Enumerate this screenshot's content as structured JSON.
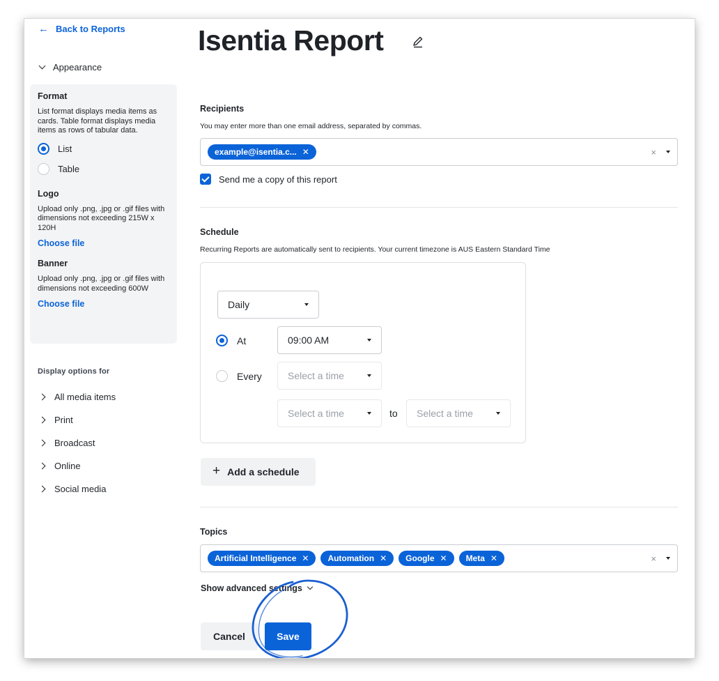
{
  "colors": {
    "accent": "#0b63d8",
    "panel_bg": "#f3f4f5",
    "scribble": "#1a5fd0"
  },
  "sidebar": {
    "back_label": "Back to Reports",
    "appearance_label": "Appearance",
    "format": {
      "heading": "Format",
      "description": "List format displays media items as cards. Table format displays media items as rows of tabular data.",
      "options": [
        {
          "label": "List",
          "selected": true
        },
        {
          "label": "Table",
          "selected": false
        }
      ]
    },
    "logo": {
      "heading": "Logo",
      "description": "Upload only .png, .jpg or .gif files with dimensions not exceeding 215W x 120H",
      "choose_label": "Choose file"
    },
    "banner": {
      "heading": "Banner",
      "description": "Upload only .png, .jpg or .gif files with dimensions not exceeding 600W",
      "choose_label": "Choose file"
    },
    "display_heading": "Display options for",
    "display_items": [
      "All media items",
      "Print",
      "Broadcast",
      "Online",
      "Social media"
    ]
  },
  "main": {
    "title": "Isentia Report",
    "recipients": {
      "heading": "Recipients",
      "description": "You may enter more than one email address, separated by commas.",
      "tags": [
        "example@isentia.c..."
      ],
      "send_copy_label": "Send me a copy of this report",
      "send_copy_checked": true
    },
    "schedule": {
      "heading": "Schedule",
      "description": "Recurring Reports are automatically sent to recipients. Your current timezone is AUS Eastern Standard Time",
      "frequency": "Daily",
      "at_label": "At",
      "at_value": "09:00 AM",
      "every_label": "Every",
      "every_placeholder": "Select a time",
      "from_placeholder": "Select a time",
      "to_label": "to",
      "to_placeholder": "Select a time",
      "mode": "At",
      "add_label": "Add a schedule"
    },
    "topics": {
      "heading": "Topics",
      "tags": [
        "Artificial Intelligence",
        "Automation",
        "Google",
        "Meta"
      ]
    },
    "advanced_label": "Show advanced settings",
    "cancel_label": "Cancel",
    "save_label": "Save"
  }
}
